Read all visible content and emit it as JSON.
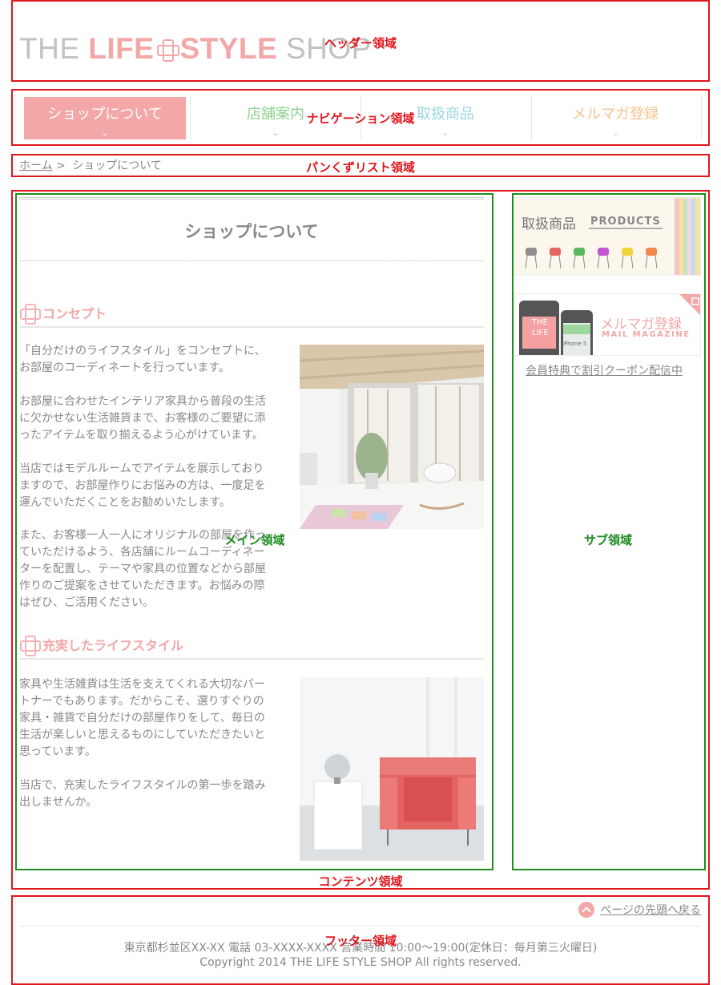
{
  "regions": {
    "header": "ヘッダー領域",
    "nav": "ナビゲーション領域",
    "breadcrumb": "パンくずリスト領域",
    "main": "メイン領域",
    "sub": "サブ領域",
    "content": "コンテンツ領域",
    "footer": "フッター領域"
  },
  "logo": {
    "part1": "THE ",
    "part2": "LIFE",
    "part3": "STYLE",
    "part4": " SHOP"
  },
  "nav": {
    "items": [
      {
        "label": "ショップについて",
        "color": "#ffffff",
        "bg": "#f3a7a7",
        "active": true
      },
      {
        "label": "店舗案内",
        "color": "#8fd38f",
        "bg": "#ffffff",
        "active": false
      },
      {
        "label": "取扱商品",
        "color": "#9bd7dd",
        "bg": "#ffffff",
        "active": false
      },
      {
        "label": "メルマガ登録",
        "color": "#f7c28d",
        "bg": "#ffffff",
        "active": false
      }
    ],
    "chevron": "⌄"
  },
  "breadcrumb": {
    "home": "ホーム",
    "separator": ">",
    "current": "ショップについて"
  },
  "main": {
    "title": "ショップについて",
    "sections": [
      {
        "heading": "コンセプト",
        "paragraphs": [
          "「自分だけのライフスタイル」をコンセプトに、お部屋のコーディネートを行っています。",
          "お部屋に合わせたインテリア家具から普段の生活に欠かせない生活雑貨まで、お客様のご要望に添ったアイテムを取り揃えるよう心がけています。",
          "当店ではモデルルームでアイテムを展示しておりますので、お部屋作りにお悩みの方は、一度足を運んでいただくことをお勧めいたします。",
          "また、お客様一人一人にオリジナルの部屋を作っていただけるよう、各店舗にルームコーディネーターを配置し、テーマや家具の位置などから部屋作りのご提案をさせていただきます。お悩みの際はぜひ、ご活用ください。"
        ]
      },
      {
        "heading": "充実したライフスタイル",
        "paragraphs": [
          "家具や生活雑貨は生活を支えてくれる大切なパートナーでもあります。だからこそ、選りすぐりの家具・雑貨で自分だけの部屋作りをして、毎日の生活が楽しいと思えるものにしていただきたいと思っています。",
          "当店で、充実したライフスタイルの第一歩を踏み出しませんか。"
        ]
      }
    ]
  },
  "sub": {
    "products_banner": {
      "jp": "取扱商品",
      "en": "PRODUCTS"
    },
    "mail_banner": {
      "jp": "メルマガ登録",
      "en": "MAIL MAGAZINE",
      "phone_text1": "THE",
      "phone_text2": "LIFE",
      "phone_text3": "iPhone 5"
    },
    "coupon": "会員特典で割引クーポン配信中"
  },
  "footer": {
    "totop": "ページの先頭へ戻る",
    "address": "東京都杉並区XX-XX 電話 03-XXXX-XXXX 営業時間 10:00～19:00(定休日：毎月第三火曜日)",
    "copyright": "Copyright 2014 THE LIFE STYLE SHOP All rights reserved."
  }
}
